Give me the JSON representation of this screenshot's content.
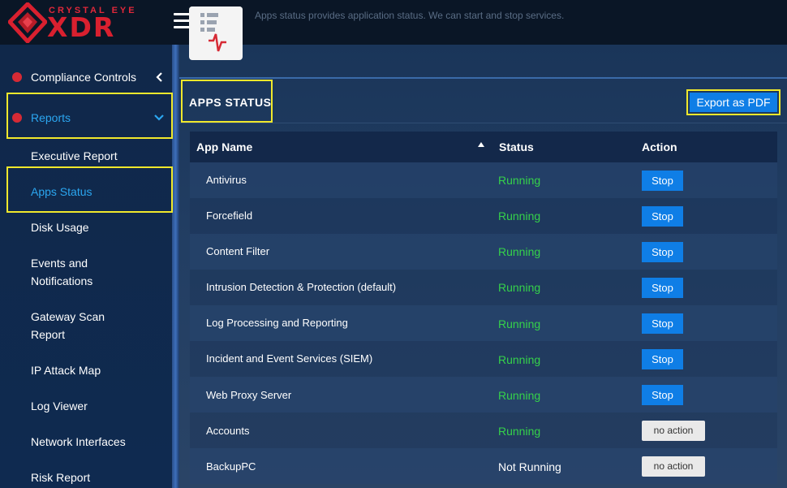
{
  "brand": {
    "top_text": "CRYSTAL EYE",
    "main_text": "XDR",
    "accent_color": "#d9202f"
  },
  "header": {
    "description": "Apps status provides application status. We can start and stop services.",
    "menu_icon": "hamburger-icon",
    "app_icon": "apps-status-icon"
  },
  "sidebar": {
    "items": [
      {
        "label": "Compliance Controls",
        "icon": "red-dot-icon",
        "chevron": "chevron-left-icon"
      },
      {
        "label": "Reports",
        "icon": "red-dot-icon",
        "chevron": "chevron-down-icon",
        "active": true
      },
      {
        "label": "Executive Report"
      },
      {
        "label": "Apps Status",
        "active": true
      },
      {
        "label": "Disk Usage"
      },
      {
        "label": "Events and Notifications"
      },
      {
        "label": "Gateway Scan Report"
      },
      {
        "label": "IP Attack Map"
      },
      {
        "label": "Log Viewer"
      },
      {
        "label": "Network Interfaces"
      },
      {
        "label": "Risk Report"
      }
    ]
  },
  "panel": {
    "title": "APPS STATUS",
    "export_label": "Export as PDF"
  },
  "table": {
    "columns": [
      "App Name",
      "Status",
      "Action"
    ],
    "rows": [
      {
        "name": "Antivirus",
        "status": "Running",
        "action": "Stop"
      },
      {
        "name": "Forcefield",
        "status": "Running",
        "action": "Stop"
      },
      {
        "name": "Content Filter",
        "status": "Running",
        "action": "Stop"
      },
      {
        "name": "Intrusion Detection & Protection (default)",
        "status": "Running",
        "action": "Stop"
      },
      {
        "name": "Log Processing and Reporting",
        "status": "Running",
        "action": "Stop"
      },
      {
        "name": "Incident and Event Services (SIEM)",
        "status": "Running",
        "action": "Stop"
      },
      {
        "name": "Web Proxy Server",
        "status": "Running",
        "action": "Stop"
      },
      {
        "name": "Accounts",
        "status": "Running",
        "action": "no action"
      },
      {
        "name": "BackupPC",
        "status": "Not Running",
        "action": "no action"
      }
    ]
  },
  "colors": {
    "running": "#35d24a",
    "button_blue": "#0f7ee6",
    "highlight": "#f0e82c",
    "active_link": "#2ba6f0"
  }
}
